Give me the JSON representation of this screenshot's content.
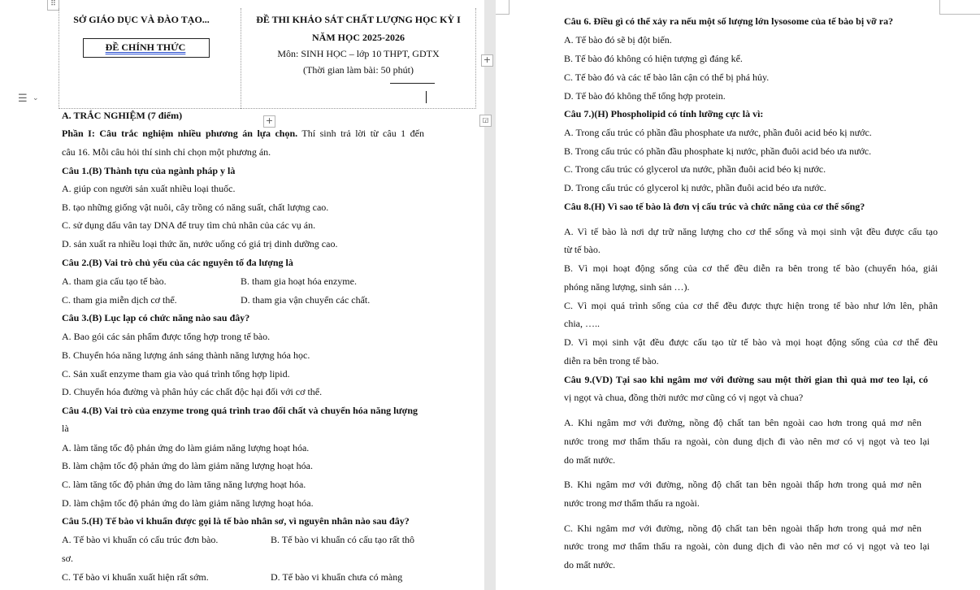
{
  "header": {
    "org": "SỞ GIÁO DỤC VÀ ĐÀO TẠO...",
    "official": "ĐỀ CHÍNH THỨC",
    "exam_title": "ĐỀ THI KHẢO SÁT CHẤT LƯỢNG HỌC KỲ I",
    "school_year": "NĂM HỌC 2025-2026",
    "subject": "Môn: SINH HỌC – lớp 10 THPT, GDTX",
    "time": "(Thời gian làm bài: 50 phút)"
  },
  "left": {
    "section": "A. TRẮC NGHIỆM (7 điểm)",
    "part_bold": "Phần I: Câu trắc nghiệm nhiều phương án lựa chọn.",
    "part_rest": " Thí sinh trả lời từ câu 1 đến",
    "part_line2": "câu 16. Mỗi câu hỏi thí sinh chỉ chọn một phương án.",
    "q1": "Câu 1.(B) Thành tựu của ngành pháp y là",
    "q1a": "A. giúp con người sản xuất nhiều loại thuốc.",
    "q1b": "B. tạo những giống vật nuôi, cây trồng có năng suất, chất lượng cao.",
    "q1c": "C. sử dụng dấu vân tay DNA để truy tìm chủ nhân của các vụ án.",
    "q1d": "D. sản xuất ra nhiều loại thức ăn, nước uống có giá trị dinh dưỡng cao.",
    "q2": "Câu 2.(B) Vai trò chủ yếu của các nguyên tố đa lượng là",
    "q2a": "A. tham gia cấu tạo tế bào.",
    "q2b": "B. tham gia hoạt hóa enzyme.",
    "q2c": "C. tham gia miễn dịch cơ thể.",
    "q2d": "D. tham gia vận chuyển các chất.",
    "q3": "Câu 3.(B) Lục lạp có chức năng nào sau đây?",
    "q3a": "A. Bao gói các sản phẩm được tổng hợp trong tế bào.",
    "q3b": "B. Chuyển hóa năng lượng ánh sáng thành năng lượng hóa học.",
    "q3c": "C. Sản xuất enzyme tham gia vào quá trình tổng hợp lipid.",
    "q3d": "D. Chuyển hóa đường và phân hủy các chất độc hại đối với cơ thể.",
    "q4": "Câu 4.(B) Vai trò của enzyme trong quá trình trao đổi chất và chuyển hóa năng lượng",
    "q4_cont": "là",
    "q4a": "A. làm tăng tốc độ phản ứng do làm giảm năng lượng hoạt hóa.",
    "q4b": "B. làm chậm tốc độ phản ứng do làm giảm năng lượng hoạt hóa.",
    "q4c": "C. làm tăng tốc độ phản ứng do làm tăng năng lượng hoạt hóa.",
    "q4d": "D. làm chậm tốc độ phản ứng do làm giảm năng lượng hoạt hóa.",
    "q5": "Câu 5.(H) Tế bào vi khuẩn được gọi là tế bào nhân sơ, vì nguyên nhân nào sau đây?",
    "q5a": "A. Tế bào vi khuẩn có cấu trúc đơn bào.",
    "q5b": "B. Tế bào vi khuẩn có cấu tạo rất thô",
    "q5b_cont": "sơ.",
    "q5c": "C. Tế bào vi khuẩn xuất hiện rất sớm.",
    "q5d": "D. Tế bào vi khuẩn chưa có màng"
  },
  "right": {
    "q6": "Câu 6. Điều gì có thể xảy ra nếu một số lượng lớn lysosome của tế bào bị vỡ ra?",
    "q6a": "A. Tế bào đó sẽ bị đột biến.",
    "q6b": "B. Tế bào đó không có hiện tượng gì đáng kể.",
    "q6c": "C. Tế bào đó và các tế bào lân cận có thể bị phá hủy.",
    "q6d": "D. Tế bào đó không thể tổng hợp protein.",
    "q7": "Câu 7.)(H) Phospholipid có tính lưỡng cực là vì:",
    "q7a": "A. Trong cấu trúc có phần đầu phosphate ưa nước, phần đuôi acid béo kị nước.",
    "q7b": "B. Trong cấu trúc có phần đầu phosphate kị nước, phần đuôi acid béo ưa nước.",
    "q7c": "C. Trong cấu trúc có glycerol ưa nước, phần đuôi acid béo kị nước.",
    "q7d": "D. Trong cấu trúc có glycerol kị nước, phần đuôi acid béo ưa nước.",
    "q8": "Câu 8.(H) Vì sao tế bào là đơn vị cấu trúc và chức năng của cơ thể sống?",
    "q8a_1": "A. Vì tế bào là nơi dự trữ năng lượng cho cơ thể sống và mọi sinh vật đều được cấu tạo",
    "q8a_2": "từ tế bào.",
    "q8b_1": "B. Vì mọi hoạt động sống của cơ thể đều diễn ra bên trong tế bào (chuyển hóa, giải",
    "q8b_2": "phóng năng lượng, sinh sản …).",
    "q8c_1": "C. Vì mọi quá trình sống của cơ thể đều được thực hiện trong tế bào như lớn lên, phân",
    "q8c_2": "chia, …..",
    "q8d_1": "D. Vì mọi sinh vật đều được cấu tạo từ tế bào và mọi hoạt động sống của cơ thể đều",
    "q8d_2": "diễn ra bên trong tế bào.",
    "q9_1": "Câu 9.(VD) Tại sao khi ngâm mơ với đường sau một thời gian thì quả mơ teo lại, có",
    "q9_2": "vị ngọt và chua, đồng thời nước mơ cũng có vị ngọt và chua?",
    "q9a_1": "A. Khi ngâm mơ với đường, nồng độ chất tan bên ngoài cao hơn trong quả mơ nên",
    "q9a_2": "nước trong mơ thẩm thấu ra ngoài, còn dung dịch đi vào nên mơ có vị ngọt và teo lại",
    "q9a_3": "do mất nước.",
    "q9b_1": "B. Khi ngâm mơ với đường, nồng độ chất tan bên ngoài thấp hơn trong quả mơ nên",
    "q9b_2": "nước trong mơ thẩm thấu ra ngoài.",
    "q9c_1": "C. Khi ngâm mơ với đường, nồng độ chất tan bên ngoài thấp hơn trong quả mơ nên",
    "q9c_2": "nước trong mơ thẩm thấu ra ngoài, còn dung dịch đi vào nên mơ có vị ngọt và teo lại",
    "q9c_3": "do mất nước."
  }
}
